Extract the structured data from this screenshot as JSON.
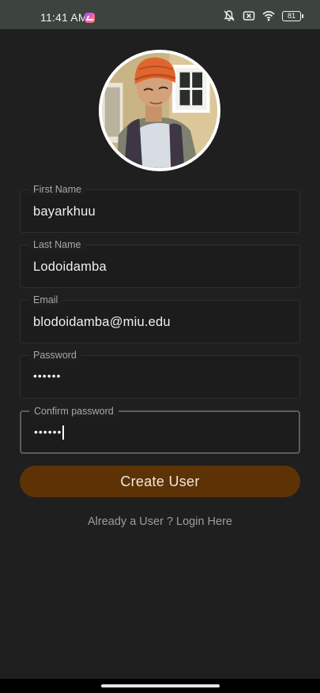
{
  "status_bar": {
    "time": "11:41 AM",
    "battery": "81",
    "icons": [
      "messenger-icon",
      "bell-off-icon",
      "sim-x-icon",
      "wifi-icon",
      "battery-icon"
    ]
  },
  "profile": {
    "avatar": "profile-photo"
  },
  "form": {
    "first_name": {
      "label": "First Name",
      "value": "bayarkhuu"
    },
    "last_name": {
      "label": "Last Name",
      "value": "Lodoidamba"
    },
    "email": {
      "label": "Email",
      "value": "blodoidamba@miu.edu"
    },
    "password": {
      "label": "Password",
      "value": "••••••"
    },
    "confirm_password": {
      "label": "Confirm password",
      "value": "••••••"
    }
  },
  "actions": {
    "create_user": "Create User",
    "login_link": "Already a User ? Login Here"
  },
  "colors": {
    "background": "#1f1f1f",
    "status_bar": "#3d443f",
    "button": "#5d3305",
    "focused_border": "#56605a"
  }
}
